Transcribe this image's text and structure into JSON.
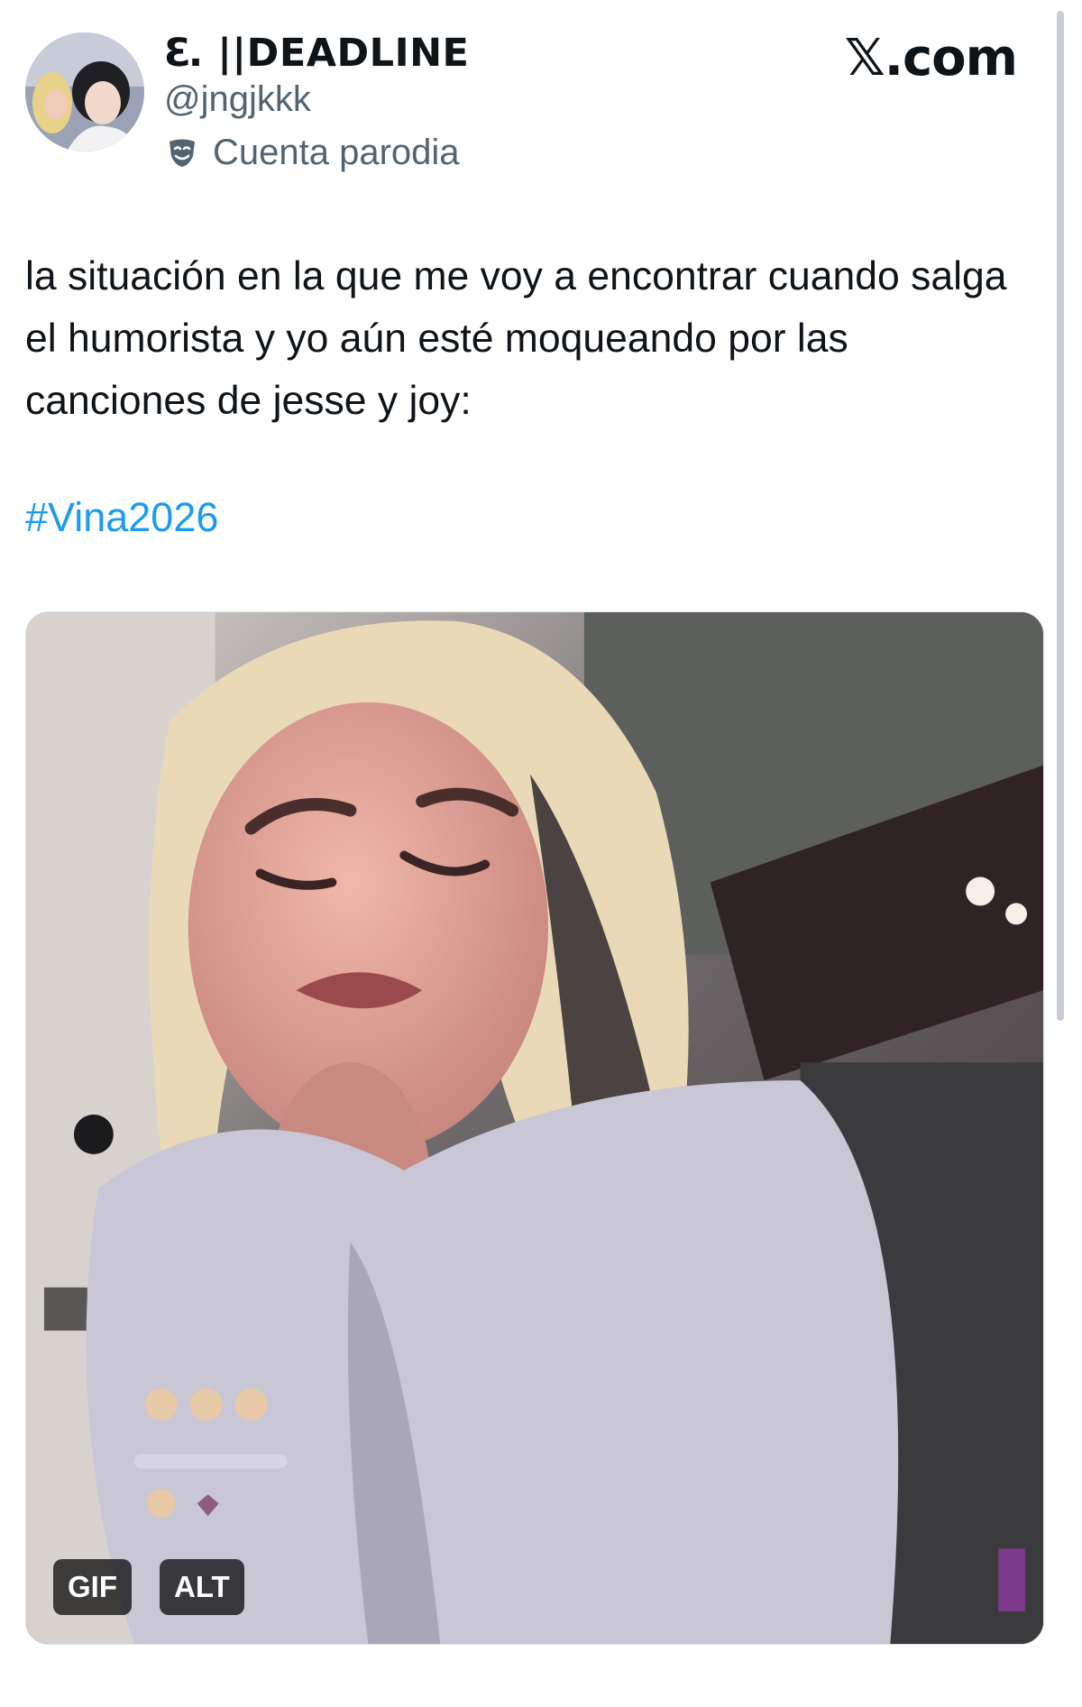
{
  "author": {
    "display_name": "ℇ. ||DEADLINE",
    "handle": "@jngjkkk",
    "account_label": "Cuenta parodia"
  },
  "brand": {
    "site": "𝕏.com"
  },
  "tweet": {
    "text": "la situación en la que me voy a encontrar cuando salga el humorista y yo aún esté moqueando por las canciones de jesse y joy:",
    "hashtag": "#Vina2026"
  },
  "media": {
    "type": "GIF",
    "badges": {
      "gif": "GIF",
      "alt": "ALT"
    }
  },
  "icons": {
    "parody": "theater-mask-icon",
    "avatar": "avatar-photo"
  },
  "colors": {
    "text": "#0f1419",
    "secondary_text": "#536471",
    "hashtag": "#1d9bf0"
  }
}
